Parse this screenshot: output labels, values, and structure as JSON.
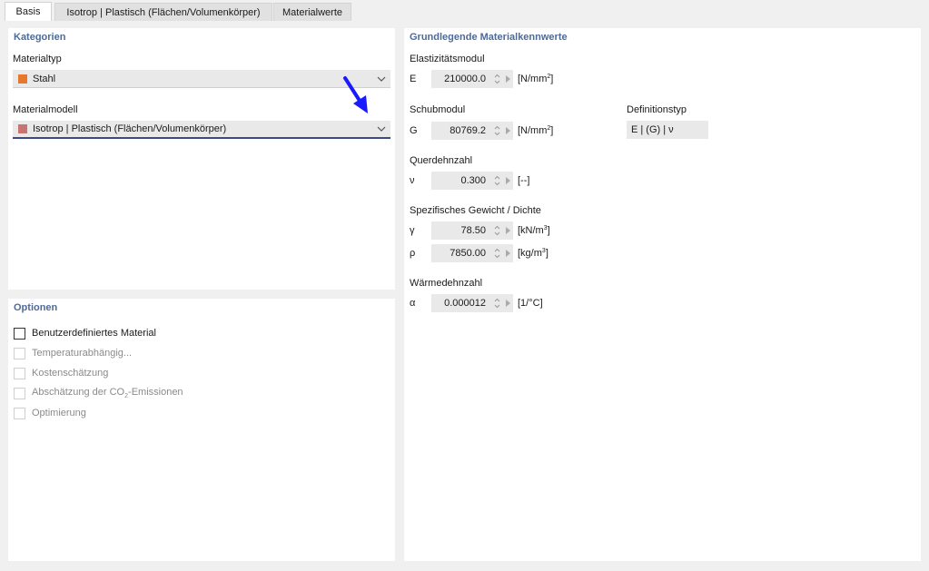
{
  "tabs": [
    {
      "label": "Basis",
      "active": true
    },
    {
      "label": "Isotrop | Plastisch (Flächen/Volumenkörper)",
      "active": false
    },
    {
      "label": "Materialwerte",
      "active": false
    }
  ],
  "kategorien": {
    "title": "Kategorien",
    "materialtyp_label": "Materialtyp",
    "materialtyp_value": "Stahl",
    "materialtyp_color": "#e8772e",
    "materialmodell_label": "Materialmodell",
    "materialmodell_value": "Isotrop | Plastisch (Flächen/Volumenkörper)",
    "materialmodell_color": "#c97373"
  },
  "optionen": {
    "title": "Optionen",
    "items": [
      {
        "label": "Benutzerdefiniertes Material",
        "enabled": true,
        "checked": false
      },
      {
        "label": "Temperaturabhängig...",
        "enabled": false,
        "checked": false
      },
      {
        "label": "Kostenschätzung",
        "enabled": false,
        "checked": false
      },
      {
        "label_prefix": "Abschätzung der CO",
        "label_sub": "2",
        "label_suffix": "-Emissionen",
        "enabled": false,
        "checked": false
      },
      {
        "label": "Optimierung",
        "enabled": false,
        "checked": false
      }
    ]
  },
  "materialkennwerte": {
    "title": "Grundlegende Materialkennwerte",
    "elastizitaet_label": "Elastizitätsmodul",
    "E": {
      "symbol": "E",
      "value": "210000.0",
      "unit_prefix": "[N/mm",
      "unit_sup": "2",
      "unit_suffix": "]"
    },
    "schubmodul_label": "Schubmodul",
    "G": {
      "symbol": "G",
      "value": "80769.2",
      "unit_prefix": "[N/mm",
      "unit_sup": "2",
      "unit_suffix": "]"
    },
    "definitionstyp_label": "Definitionstyp",
    "definitionstyp_value": "E | (G) | ν",
    "querdehnzahl_label": "Querdehnzahl",
    "nu": {
      "symbol": "ν",
      "value": "0.300",
      "unit_prefix": "[--]",
      "unit_sup": "",
      "unit_suffix": ""
    },
    "gewicht_label": "Spezifisches Gewicht / Dichte",
    "gamma": {
      "symbol": "γ",
      "value": "78.50",
      "unit_prefix": "[kN/m",
      "unit_sup": "3",
      "unit_suffix": "]"
    },
    "rho": {
      "symbol": "ρ",
      "value": "7850.00",
      "unit_prefix": "[kg/m",
      "unit_sup": "3",
      "unit_suffix": "]"
    },
    "waerme_label": "Wärmedehnzahl",
    "alpha": {
      "symbol": "α",
      "value": "0.000012",
      "unit_prefix": "[1/°C]",
      "unit_sup": "",
      "unit_suffix": ""
    }
  },
  "colors": {
    "title_blue": "#4d6a99",
    "annotation_arrow": "#1a1aff"
  }
}
